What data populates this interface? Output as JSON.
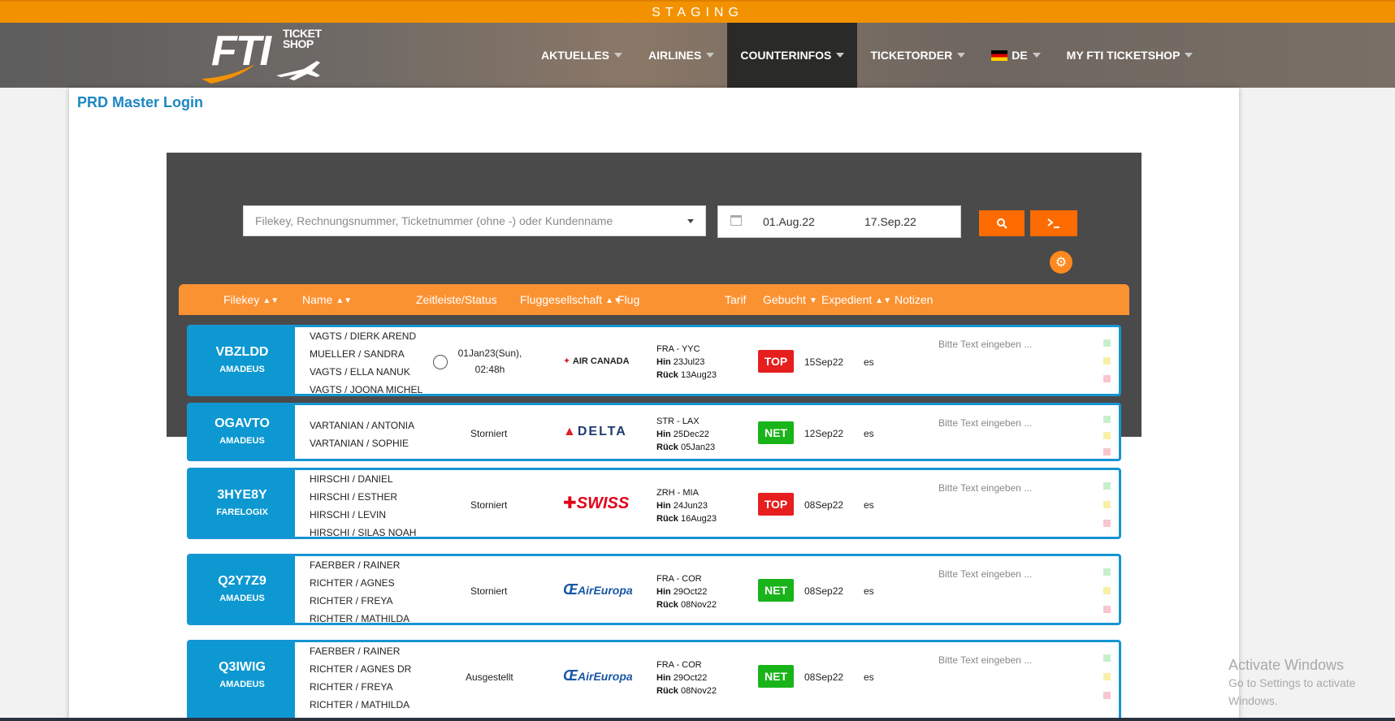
{
  "staging": {
    "label": "STAGING"
  },
  "nav": {
    "logo_big": "FTI",
    "logo_small_1": "TICKET",
    "logo_small_2": "SHOP",
    "items": [
      {
        "label": "AKTUELLES"
      },
      {
        "label": "AIRLINES"
      },
      {
        "label": "COUNTERINFOS"
      },
      {
        "label": "TICKETORDER"
      },
      {
        "label": "DE"
      },
      {
        "label": "MY FTI TICKETSHOP"
      }
    ]
  },
  "page": {
    "title": "PRD Master Login"
  },
  "search": {
    "placeholder": "Filekey, Rechnungsnummer, Ticketnummer (ohne -) oder Kundenname",
    "date_from": "01.Aug.22",
    "date_to": "17.Sep.22"
  },
  "table": {
    "headers": [
      "Filekey",
      "Name",
      "Zeitleiste/Status",
      "Fluggesellschaft",
      "Flug",
      "Tarif",
      "Gebucht",
      "Expedient",
      "Notizen"
    ],
    "rows": [
      {
        "filekey": "VBZLDD",
        "system": "AMADEUS",
        "names": [
          "VAGTS / DIERK AREND",
          "MUELLER / SANDRA",
          "VAGTS / ELLA NANUK",
          "VAGTS / JOONA MICHEL"
        ],
        "status_line1": "01Jan23(Sun),",
        "status_line2": "02:48h",
        "airline": "AIR CANADA",
        "route": "FRA - YYC",
        "hin_label": "Hin",
        "hin": "23Jul23",
        "rueck_label": "Rück",
        "rueck": "13Aug23",
        "tarif": "TOP",
        "gebucht": "15Sep22",
        "expedient": "es",
        "note_placeholder": "Bitte Text eingeben ..."
      },
      {
        "filekey": "OGAVTO",
        "system": "AMADEUS",
        "names": [
          "VARTANIAN / ANTONIA",
          "VARTANIAN / SOPHIE"
        ],
        "status_line1": "Storniert",
        "status_line2": "",
        "airline": "DELTA",
        "route": "STR - LAX",
        "hin_label": "Hin",
        "hin": "25Dec22",
        "rueck_label": "Rück",
        "rueck": "05Jan23",
        "tarif": "NET",
        "gebucht": "12Sep22",
        "expedient": "es",
        "note_placeholder": "Bitte Text eingeben ..."
      },
      {
        "filekey": "3HYE8Y",
        "system": "FARELOGIX",
        "names": [
          "HIRSCHI / DANIEL",
          "HIRSCHI / ESTHER",
          "HIRSCHI / LEVIN",
          "HIRSCHI / SILAS NOAH"
        ],
        "status_line1": "Storniert",
        "status_line2": "",
        "airline": "SWISS",
        "route": "ZRH - MIA",
        "hin_label": "Hin",
        "hin": "24Jun23",
        "rueck_label": "Rück",
        "rueck": "16Aug23",
        "tarif": "TOP",
        "gebucht": "08Sep22",
        "expedient": "es",
        "note_placeholder": "Bitte Text eingeben ..."
      },
      {
        "filekey": "Q2Y7Z9",
        "system": "AMADEUS",
        "names": [
          "FAERBER / RAINER",
          "RICHTER / AGNES",
          "RICHTER / FREYA",
          "RICHTER / MATHILDA"
        ],
        "status_line1": "Storniert",
        "status_line2": "",
        "airline": "AirEuropa",
        "route": "FRA - COR",
        "hin_label": "Hin",
        "hin": "29Oct22",
        "rueck_label": "Rück",
        "rueck": "08Nov22",
        "tarif": "NET",
        "gebucht": "08Sep22",
        "expedient": "es",
        "note_placeholder": "Bitte Text eingeben ..."
      },
      {
        "filekey": "Q3IWIG",
        "system": "AMADEUS",
        "names": [
          "FAERBER / RAINER",
          "RICHTER / AGNES DR",
          "RICHTER / FREYA",
          "RICHTER / MATHILDA"
        ],
        "status_line1": "Ausgestellt",
        "status_line2": "",
        "airline": "AirEuropa",
        "route": "FRA - COR",
        "hin_label": "Hin",
        "hin": "29Oct22",
        "rueck_label": "Rück",
        "rueck": "08Nov22",
        "tarif": "NET",
        "gebucht": "08Sep22",
        "expedient": "es",
        "note_placeholder": "Bitte Text eingeben ..."
      }
    ]
  },
  "watermark": {
    "line1": "Activate Windows",
    "line2": "Go to Settings to activate Windows."
  },
  "colors": {
    "accent": "#f39200",
    "filekey_bg": "#0d98d1",
    "top": "#e61e1e",
    "net": "#19b419"
  }
}
